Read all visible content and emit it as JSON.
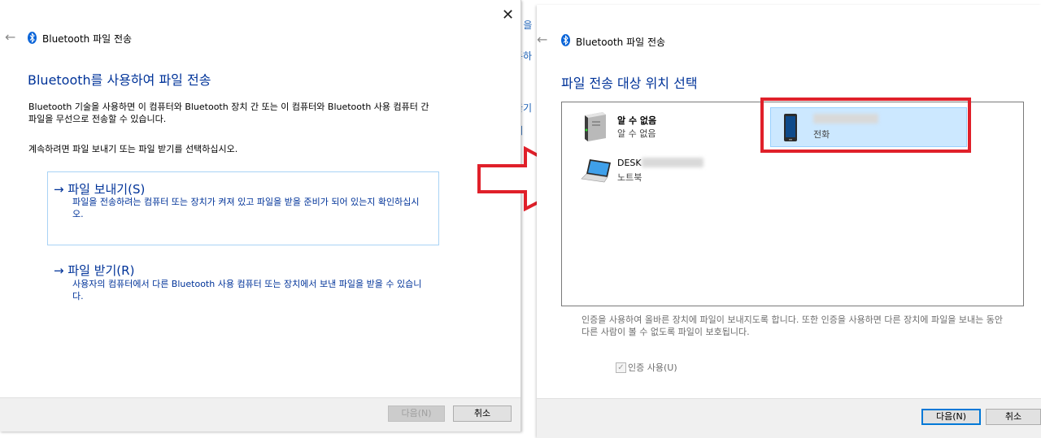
{
  "left_dialog": {
    "header_title": "Bluetooth 파일 전송",
    "main_title": "Bluetooth를 사용하여 파일 전송",
    "description": "Bluetooth 기술을 사용하면 이 컴퓨터와 Bluetooth 장치 간 또는 이 컴퓨터와 Bluetooth 사용 컴퓨터 간 파일을 무선으로 전송할 수 있습니다.",
    "instruction": "계속하려면 파일 보내기 또는 파일 받기를 선택하십시오.",
    "send_title": "→ 파일 보내기(S)",
    "send_desc": "파일을 전송하려는 컴퓨터 또는 장치가 켜져 있고 파일을 받을 준비가 되어 있는지 확인하십시오.",
    "receive_title": "→ 파일 받기(R)",
    "receive_desc": "사용자의 컴퓨터에서 다른 Bluetooth 사용 컴퓨터 또는 장치에서 보낸 파일을 받을 수 있습니다.",
    "next_button": "다음(N)",
    "cancel_button": "취소",
    "close_glyph": "✕"
  },
  "right_dialog": {
    "header_title": "Bluetooth 파일 전송",
    "main_title": "파일 전송 대상 위치 선택",
    "devices": [
      {
        "name": "알 수 없음",
        "type": "알 수 없음",
        "icon": "tower-pc-icon"
      },
      {
        "name": "",
        "type": "전화",
        "icon": "phone-icon",
        "selected": true
      },
      {
        "name": "DESK",
        "type": "노트북",
        "icon": "laptop-icon"
      }
    ],
    "auth_note": "인증을 사용하여 올바른 장치에 파일이 보내지도록 합니다. 또한 인증을 사용하면 다른 장치에 파일을 보내는 동안 다른 사람이 볼 수 없도록 파일이 보호됩니다.",
    "use_auth_label": "인증 사용(U)",
    "use_auth_checked": true,
    "next_button": "다음(N)",
    "cancel_button": "취소"
  },
  "behind_window_fragments": [
    "h 을",
    "통하",
    "끌기",
    "내"
  ],
  "colors": {
    "accent_blue": "#003399",
    "selection_fill": "#cce8ff",
    "highlight_red": "#e0202a",
    "arrow_red": "#e0202a"
  }
}
